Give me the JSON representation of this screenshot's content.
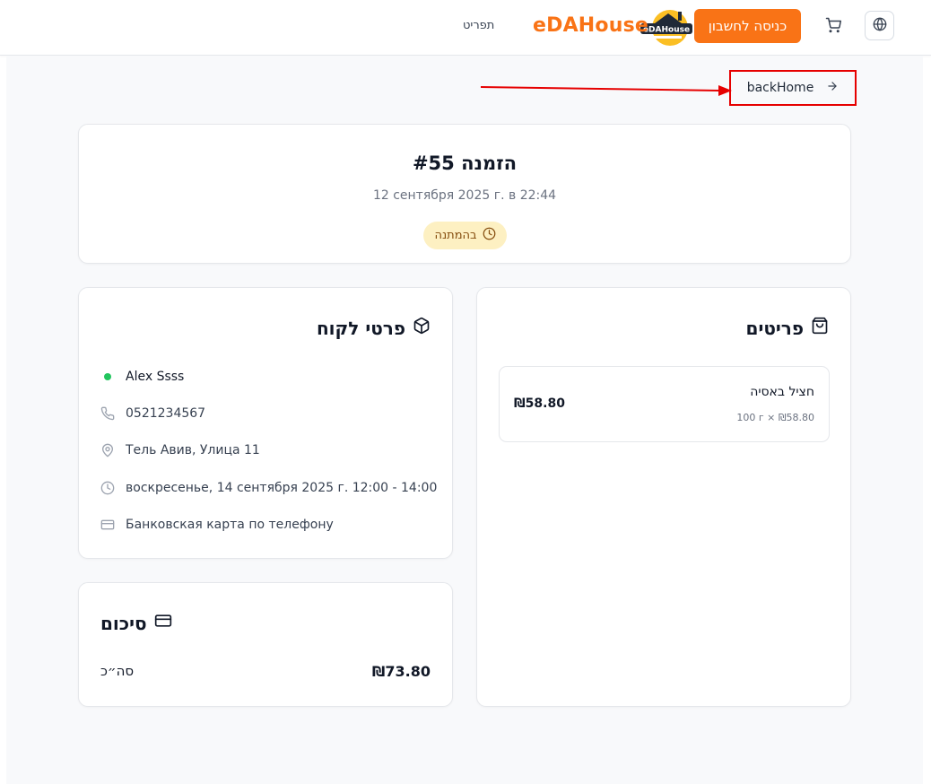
{
  "header": {
    "brand": "eDAHouse",
    "login_label": "כניסה לחשבון",
    "menu_label": "תפריט",
    "logo_text": "eDAHouse"
  },
  "back": {
    "label": "backHome"
  },
  "order": {
    "title": "הזמנה #55",
    "date": "12 сентября 2025 г. в 22:44",
    "status": "בהמתנה"
  },
  "items": {
    "heading": "פריטים",
    "list": [
      {
        "name": "חציל באסיה",
        "meta": "100 г × ₪58.80",
        "price": "₪58.80"
      }
    ]
  },
  "customer": {
    "heading": "פרטי לקוח",
    "name": "Alex Ssss",
    "phone": "0521234567",
    "address": "Тель Авив, Улица 11",
    "delivery": "воскресенье, 14 сентября 2025 г. 12:00 - 14:00",
    "payment": "Банковская карта по телефону"
  },
  "summary": {
    "heading": "סיכום",
    "total_label": "סה״כ",
    "total_value": "₪73.80"
  },
  "colors": {
    "accent": "#f97316",
    "status_bg": "#fdf0c2",
    "annotation": "#e60000"
  }
}
